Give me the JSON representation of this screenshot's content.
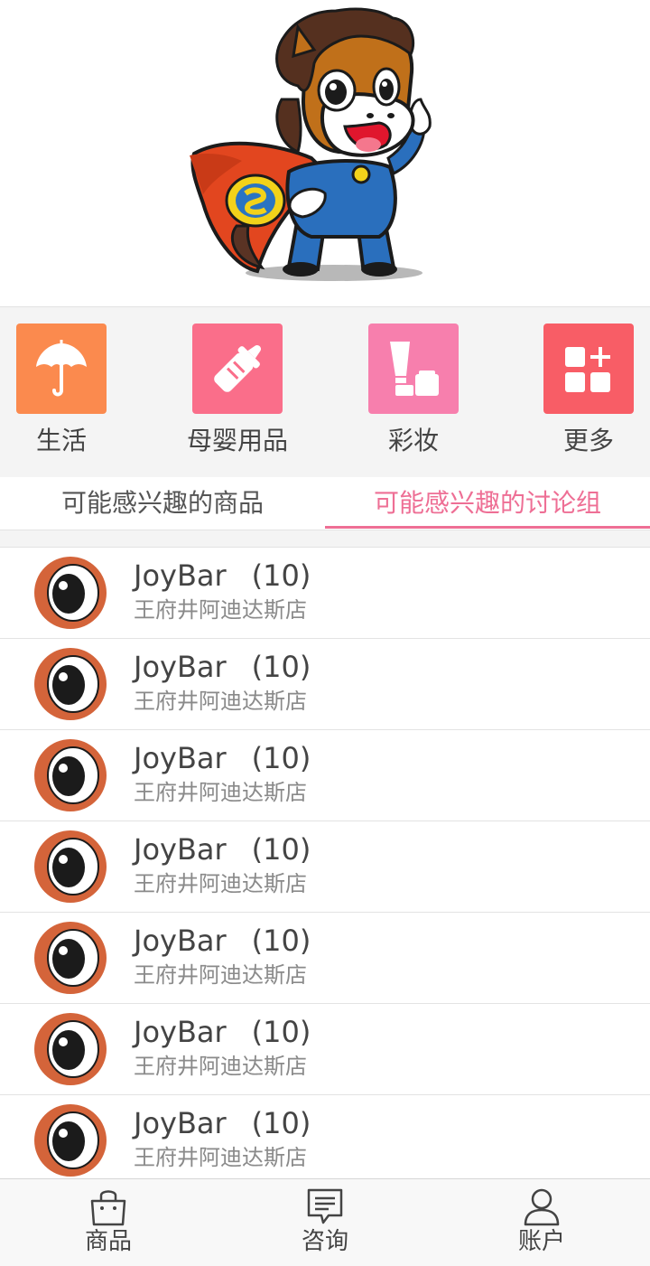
{
  "categories": [
    {
      "label": "生活",
      "icon": "umbrella-icon",
      "color": "#fb8a4e"
    },
    {
      "label": "母婴用品",
      "icon": "baby-bottle-icon",
      "color": "#fa6e8a"
    },
    {
      "label": "彩妆",
      "icon": "cosmetics-icon",
      "color": "#f77fad"
    },
    {
      "label": "更多",
      "icon": "more-grid-icon",
      "color": "#f85d66"
    }
  ],
  "tabs": {
    "left": "可能感兴趣的商品",
    "right": "可能感兴趣的讨论组",
    "active_color": "#ee6f95"
  },
  "groups": [
    {
      "name": "JoyBar",
      "count": "(10)",
      "store": "王府井阿迪达斯店"
    },
    {
      "name": "JoyBar",
      "count": "(10)",
      "store": "王府井阿迪达斯店"
    },
    {
      "name": "JoyBar",
      "count": "(10)",
      "store": "王府井阿迪达斯店"
    },
    {
      "name": "JoyBar",
      "count": "(10)",
      "store": "王府井阿迪达斯店"
    },
    {
      "name": "JoyBar",
      "count": "(10)",
      "store": "王府井阿迪达斯店"
    },
    {
      "name": "JoyBar",
      "count": "(10)",
      "store": "王府井阿迪达斯店"
    },
    {
      "name": "JoyBar",
      "count": "(10)",
      "store": "王府井阿迪达斯店"
    }
  ],
  "bottom_nav": [
    {
      "label": "商品",
      "icon": "shopping-bag-icon"
    },
    {
      "label": "咨询",
      "icon": "chat-bubble-icon"
    },
    {
      "label": "账户",
      "icon": "user-icon"
    }
  ]
}
